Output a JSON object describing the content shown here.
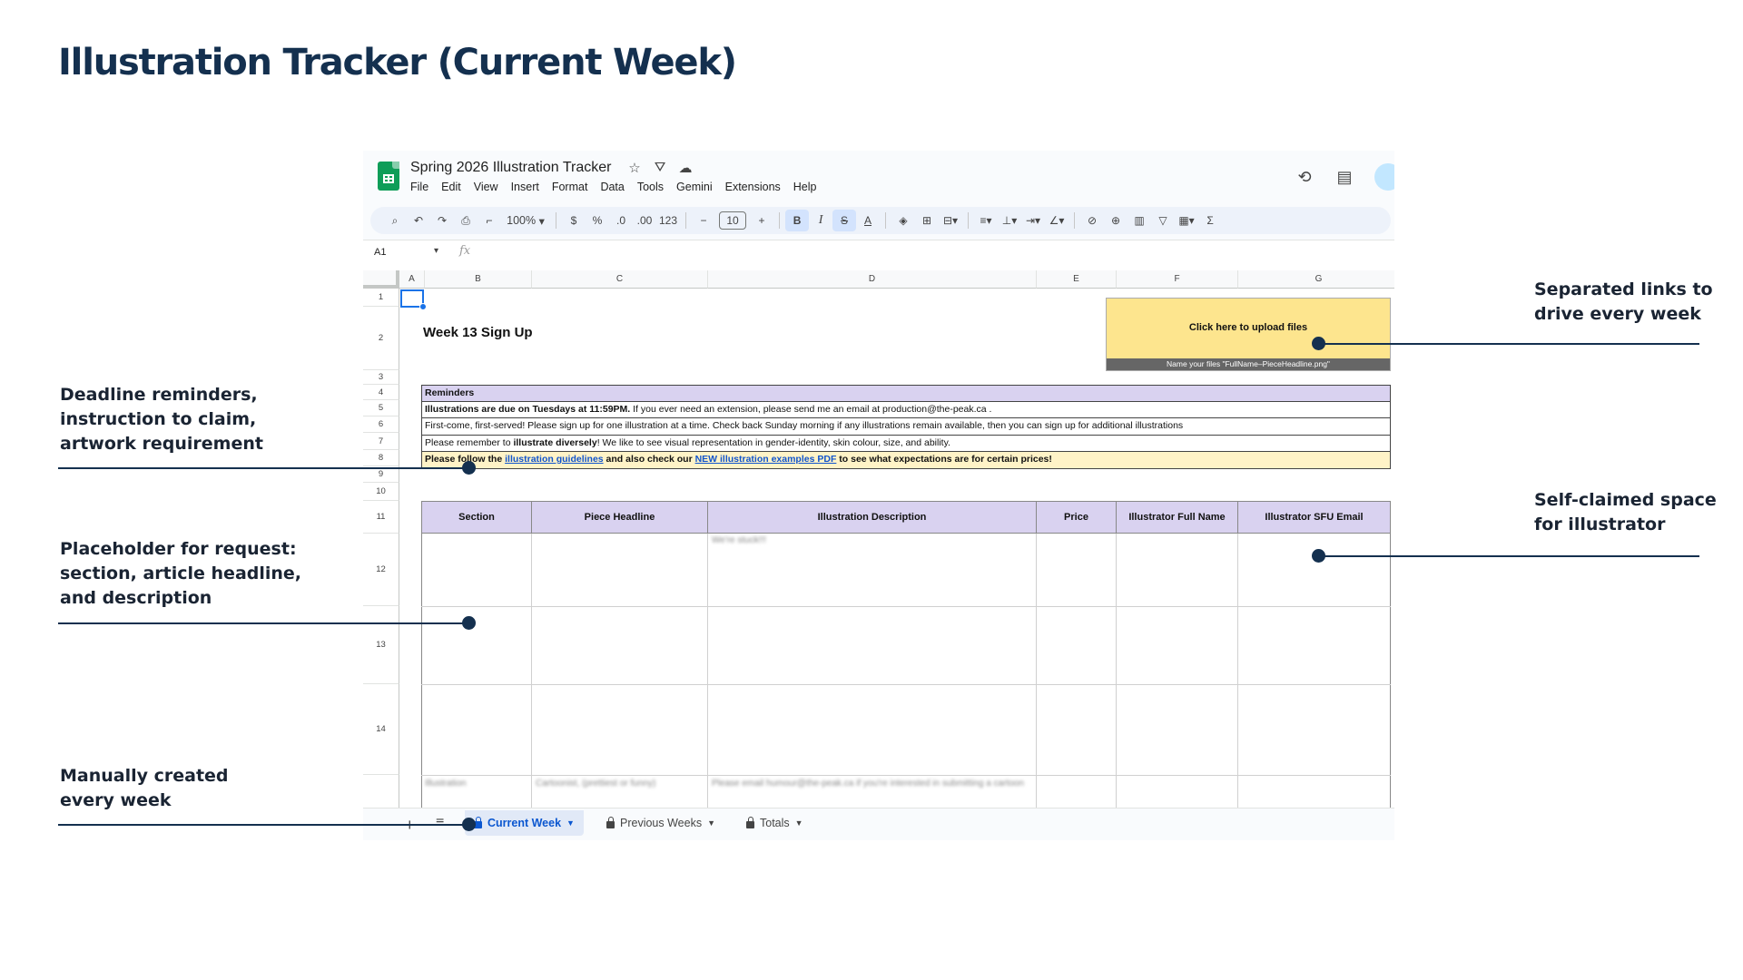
{
  "slide": {
    "title": "Illustration Tracker (Current Week)"
  },
  "sheets": {
    "doc_title": "Spring 2026 Illustration Tracker",
    "menu": [
      "File",
      "Edit",
      "View",
      "Insert",
      "Format",
      "Data",
      "Tools",
      "Gemini",
      "Extensions",
      "Help"
    ],
    "toolbar": {
      "zoom": "100%",
      "currency": "$",
      "percent": "%",
      "dec_decrease": ".0",
      "dec_increase": ".00",
      "number_format": "123",
      "font_size": "10",
      "bold": "B",
      "italic": "I",
      "strike": "S",
      "text_color": "A"
    },
    "name_box": "A1",
    "fx": "fx",
    "columns": [
      "A",
      "B",
      "C",
      "D",
      "E",
      "F",
      "G"
    ],
    "rows": [
      "1",
      "2",
      "3",
      "4",
      "5",
      "6",
      "7",
      "8",
      "9",
      "10",
      "11",
      "12",
      "13",
      "14"
    ],
    "week_title": "Week 13 Sign Up",
    "upload": {
      "label": "Click here to upload files",
      "note": "Name your files \"FullName–PieceHeadline.png\""
    },
    "reminders": {
      "header": "Reminders",
      "line1_bold": "Illustrations are due on Tuesdays at 11:59PM.",
      "line1_rest": " If you ever need an extension, please send me an email at production@the-peak.ca .",
      "line2": "First-come, first-served! Please sign up for one illustration at a time. Check back Sunday morning if any illustrations remain available, then you can sign up for additional illustrations",
      "line3_pre": "Please remember to ",
      "line3_bold": "illustrate diversely",
      "line3_post": "! We like to see visual representation in gender-identity, skin colour, size, and ability.",
      "line4_pre": "Please follow the ",
      "line4_link1": "illustration guidelines",
      "line4_mid": " and also check our ",
      "line4_link2": " NEW illustration examples PDF",
      "line4_post": " to see what expectations are for certain prices!"
    },
    "table_headers": [
      "Section",
      "Piece Headline",
      "Illustration Description",
      "Price",
      "Illustrator Full Name",
      "Illustrator SFU Email"
    ],
    "blurred_text": {
      "row12_desc": "We're stuck!!!",
      "row15_section": "Illustration",
      "row15_headline": "Cartoonist, (prettiest or funny)",
      "row15_desc": "Please email humour@the-peak.ca if you're interested in submitting a cartoon"
    },
    "tabs": [
      {
        "label": "Current Week",
        "active": true
      },
      {
        "label": "Previous Weeks",
        "active": false
      },
      {
        "label": "Totals",
        "active": false
      }
    ]
  },
  "annotations": {
    "deadline": [
      "Deadline reminders,",
      "instruction to claim,",
      "artwork requirement"
    ],
    "placeholder": [
      "Placeholder for request:",
      "section, article headline,",
      "and description"
    ],
    "manual": [
      "Manually created",
      "every week"
    ],
    "links": [
      "Separated links to",
      "drive every week"
    ],
    "selfclaim": [
      "Self-claimed space",
      "for illustrator"
    ]
  },
  "colors": {
    "title": "#14304f",
    "accent_line": "#14304f",
    "sheets_green": "#0f9d58",
    "header_purple": "#d9d2f0",
    "upload_yellow": "#fde58e"
  }
}
